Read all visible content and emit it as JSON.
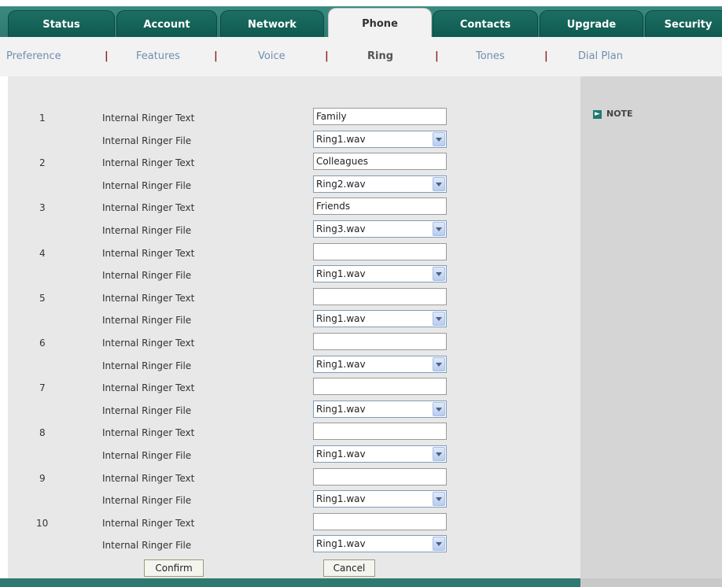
{
  "tabs": [
    {
      "label": "Status"
    },
    {
      "label": "Account"
    },
    {
      "label": "Network"
    },
    {
      "label": "Phone"
    },
    {
      "label": "Contacts"
    },
    {
      "label": "Upgrade"
    },
    {
      "label": "Security"
    }
  ],
  "subnav": {
    "items": [
      {
        "label": "Preference"
      },
      {
        "label": "Features"
      },
      {
        "label": "Voice"
      },
      {
        "label": "Ring"
      },
      {
        "label": "Tones"
      },
      {
        "label": "Dial Plan"
      }
    ],
    "separator": "|"
  },
  "sidebar": {
    "note_label": "NOTE"
  },
  "rings": [
    {
      "number": "1",
      "text_label": "Internal Ringer Text",
      "text_value": "Family",
      "file_label": "Internal Ringer File",
      "file_value": "Ring1.wav"
    },
    {
      "number": "2",
      "text_label": "Internal Ringer Text",
      "text_value": "Colleagues",
      "file_label": "Internal Ringer File",
      "file_value": "Ring2.wav"
    },
    {
      "number": "3",
      "text_label": "Internal Ringer Text",
      "text_value": "Friends",
      "file_label": "Internal Ringer File",
      "file_value": "Ring3.wav"
    },
    {
      "number": "4",
      "text_label": "Internal Ringer Text",
      "text_value": "",
      "file_label": "Internal Ringer File",
      "file_value": "Ring1.wav"
    },
    {
      "number": "5",
      "text_label": "Internal Ringer Text",
      "text_value": "",
      "file_label": "Internal Ringer File",
      "file_value": "Ring1.wav"
    },
    {
      "number": "6",
      "text_label": "Internal Ringer Text",
      "text_value": "",
      "file_label": "Internal Ringer File",
      "file_value": "Ring1.wav"
    },
    {
      "number": "7",
      "text_label": "Internal Ringer Text",
      "text_value": "",
      "file_label": "Internal Ringer File",
      "file_value": "Ring1.wav"
    },
    {
      "number": "8",
      "text_label": "Internal Ringer Text",
      "text_value": "",
      "file_label": "Internal Ringer File",
      "file_value": "Ring1.wav"
    },
    {
      "number": "9",
      "text_label": "Internal Ringer Text",
      "text_value": "",
      "file_label": "Internal Ringer File",
      "file_value": "Ring1.wav"
    },
    {
      "number": "10",
      "text_label": "Internal Ringer Text",
      "text_value": "",
      "file_label": "Internal Ringer File",
      "file_value": "Ring1.wav"
    }
  ],
  "buttons": {
    "confirm": "Confirm",
    "cancel": "Cancel"
  },
  "colors": {
    "tab_bg": "#0f5a50",
    "tab_active_bg": "#f2f2f2",
    "link": "#6e8fb0",
    "separator": "#8a1f1f",
    "content_bg": "#e8e8e8",
    "sidebar_bg": "#d5d5d5"
  }
}
